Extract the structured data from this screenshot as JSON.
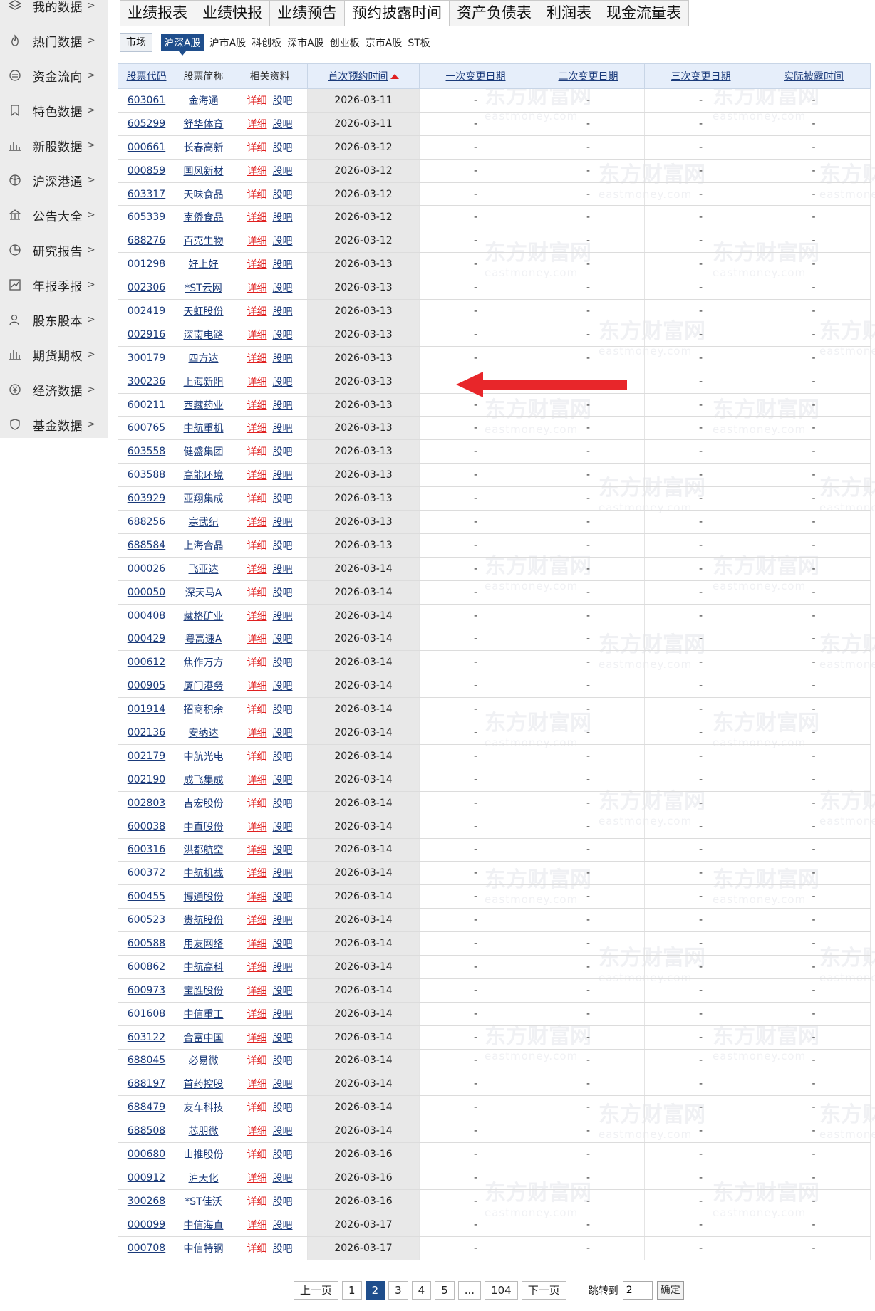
{
  "sidebar": {
    "items": [
      {
        "label": "我的数据",
        "icon": "layers-icon"
      },
      {
        "label": "热门数据",
        "icon": "fire-icon"
      },
      {
        "label": "资金流向",
        "icon": "flow-icon"
      },
      {
        "label": "特色数据",
        "icon": "bookmark-icon"
      },
      {
        "label": "新股数据",
        "icon": "bar-chart-icon"
      },
      {
        "label": "沪深港通",
        "icon": "globe-icon"
      },
      {
        "label": "公告大全",
        "icon": "bank-icon"
      },
      {
        "label": "研究报告",
        "icon": "pie-icon"
      },
      {
        "label": "年报季报",
        "icon": "line-chart-icon"
      },
      {
        "label": "股东股本",
        "icon": "user-icon"
      },
      {
        "label": "期货期权",
        "icon": "column-icon"
      },
      {
        "label": "经济数据",
        "icon": "yen-icon"
      },
      {
        "label": "基金数据",
        "icon": "shield-icon"
      }
    ],
    "chevron": ">"
  },
  "tabs": [
    "业绩报表",
    "业绩快报",
    "业绩预告",
    "预约披露时间",
    "资产负债表",
    "利润表",
    "现金流量表"
  ],
  "active_tab": "预约披露时间",
  "market": {
    "label": "市场",
    "options": [
      "沪深A股",
      "沪市A股",
      "科创板",
      "深市A股",
      "创业板",
      "京市A股",
      "ST板"
    ],
    "active": "沪深A股"
  },
  "table": {
    "headers": [
      "股票代码",
      "股票简称",
      "相关资料",
      "首次预约时间",
      "一次变更日期",
      "二次变更日期",
      "三次变更日期",
      "实际披露时间"
    ],
    "link_detail": "详细",
    "link_bar": "股吧",
    "empty": "-",
    "rows": [
      [
        "603061",
        "金海通",
        "2026-03-11"
      ],
      [
        "605299",
        "舒华体育",
        "2026-03-11"
      ],
      [
        "000661",
        "长春高新",
        "2026-03-12"
      ],
      [
        "000859",
        "国风新材",
        "2026-03-12"
      ],
      [
        "603317",
        "天味食品",
        "2026-03-12"
      ],
      [
        "605339",
        "南侨食品",
        "2026-03-12"
      ],
      [
        "688276",
        "百克生物",
        "2026-03-12"
      ],
      [
        "001298",
        "好上好",
        "2026-03-13"
      ],
      [
        "002306",
        "*ST云网",
        "2026-03-13"
      ],
      [
        "002419",
        "天虹股份",
        "2026-03-13"
      ],
      [
        "002916",
        "深南电路",
        "2026-03-13"
      ],
      [
        "300179",
        "四方达",
        "2026-03-13"
      ],
      [
        "300236",
        "上海新阳",
        "2026-03-13"
      ],
      [
        "600211",
        "西藏药业",
        "2026-03-13"
      ],
      [
        "600765",
        "中航重机",
        "2026-03-13"
      ],
      [
        "603558",
        "健盛集团",
        "2026-03-13"
      ],
      [
        "603588",
        "高能环境",
        "2026-03-13"
      ],
      [
        "603929",
        "亚翔集成",
        "2026-03-13"
      ],
      [
        "688256",
        "寒武纪",
        "2026-03-13"
      ],
      [
        "688584",
        "上海合晶",
        "2026-03-13"
      ],
      [
        "000026",
        "飞亚达",
        "2026-03-14"
      ],
      [
        "000050",
        "深天马A",
        "2026-03-14"
      ],
      [
        "000408",
        "藏格矿业",
        "2026-03-14"
      ],
      [
        "000429",
        "粤高速A",
        "2026-03-14"
      ],
      [
        "000612",
        "焦作万方",
        "2026-03-14"
      ],
      [
        "000905",
        "厦门港务",
        "2026-03-14"
      ],
      [
        "001914",
        "招商积余",
        "2026-03-14"
      ],
      [
        "002136",
        "安纳达",
        "2026-03-14"
      ],
      [
        "002179",
        "中航光电",
        "2026-03-14"
      ],
      [
        "002190",
        "成飞集成",
        "2026-03-14"
      ],
      [
        "002803",
        "吉宏股份",
        "2026-03-14"
      ],
      [
        "600038",
        "中直股份",
        "2026-03-14"
      ],
      [
        "600316",
        "洪都航空",
        "2026-03-14"
      ],
      [
        "600372",
        "中航机载",
        "2026-03-14"
      ],
      [
        "600455",
        "博通股份",
        "2026-03-14"
      ],
      [
        "600523",
        "贵航股份",
        "2026-03-14"
      ],
      [
        "600588",
        "用友网络",
        "2026-03-14"
      ],
      [
        "600862",
        "中航高科",
        "2026-03-14"
      ],
      [
        "600973",
        "宝胜股份",
        "2026-03-14"
      ],
      [
        "601608",
        "中信重工",
        "2026-03-14"
      ],
      [
        "603122",
        "合富中国",
        "2026-03-14"
      ],
      [
        "688045",
        "必易微",
        "2026-03-14"
      ],
      [
        "688197",
        "首药控股",
        "2026-03-14"
      ],
      [
        "688479",
        "友车科技",
        "2026-03-14"
      ],
      [
        "688508",
        "芯朋微",
        "2026-03-14"
      ],
      [
        "000680",
        "山推股份",
        "2026-03-16"
      ],
      [
        "000912",
        "泸天化",
        "2026-03-16"
      ],
      [
        "300268",
        "*ST佳沃",
        "2026-03-16"
      ],
      [
        "000099",
        "中信海直",
        "2026-03-17"
      ],
      [
        "000708",
        "中信特钢",
        "2026-03-17"
      ]
    ]
  },
  "watermark": {
    "cn": "东方财富网",
    "en": "eastmoney.com"
  },
  "pager": {
    "prev": "上一页",
    "pages": [
      "1",
      "2",
      "3",
      "4",
      "5",
      "...",
      "104"
    ],
    "current": "2",
    "next": "下一页",
    "jump_label": "跳转到",
    "jump_value": "2",
    "confirm": "确定"
  },
  "colors": {
    "accent": "#1f4e8c",
    "link": "#1a3a7a",
    "red": "#e02020",
    "header_bg": "#e6eefa",
    "arrow": "#e8262a"
  }
}
